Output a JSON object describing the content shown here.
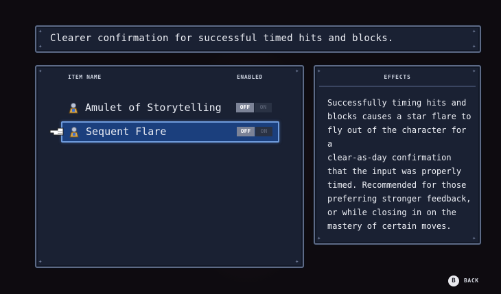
{
  "description": "Clearer confirmation for successful timed hits and blocks.",
  "items_panel": {
    "header_name": "ITEM NAME",
    "header_enabled": "ENABLED",
    "items": [
      {
        "label": "Amulet of Storytelling",
        "icon": "amulet-icon",
        "off": "OFF",
        "on": "ON",
        "enabled": false
      },
      {
        "label": "Sequent Flare",
        "icon": "amulet-icon",
        "off": "OFF",
        "on": "ON",
        "enabled": false,
        "selected": true
      }
    ]
  },
  "effects": {
    "title": "EFFECTS",
    "text": "Successfully timing hits and\nblocks causes a star flare to\nfly out of the character for a\nclear-as-day confirmation\nthat the input was properly\ntimed. Recommended for those\npreferring stronger feedback,\nor while closing in on the\nmastery of certain moves."
  },
  "footer": {
    "button": "B",
    "label": "BACK"
  },
  "colors": {
    "panel": "#1a2133",
    "border": "#5d6a86",
    "selection": "#1b3f7d",
    "selection_border": "#6f9bdc"
  }
}
